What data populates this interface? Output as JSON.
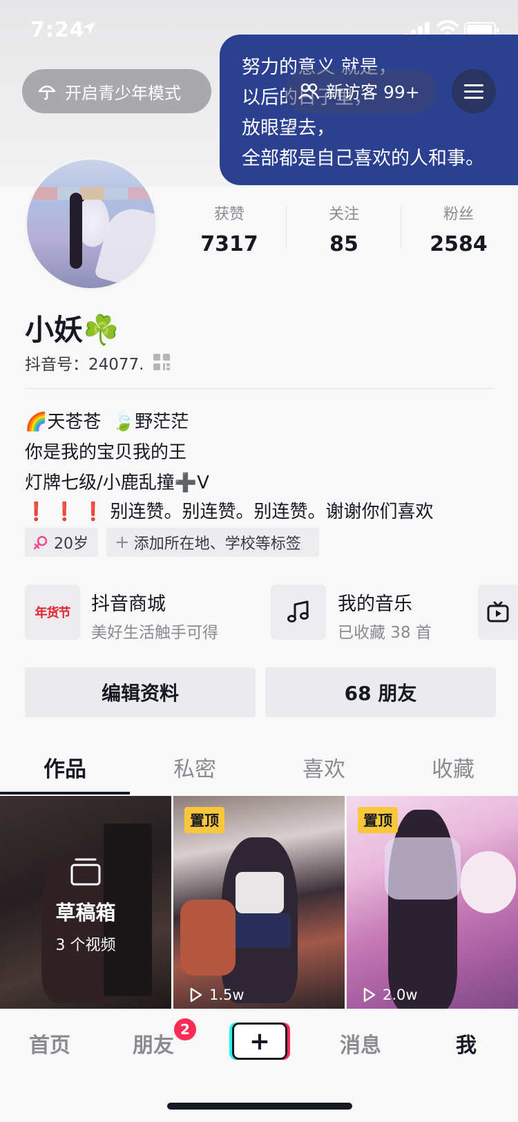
{
  "status_bar": {
    "time": "7:24"
  },
  "header": {
    "teen_mode_label": "开启青少年模式",
    "note_text": "努力的意义 就是，\n以后的日子里，\n放眼望去，\n全部都是自己喜欢的人和事。",
    "visitors_label": "新访客 99+"
  },
  "stats": [
    {
      "label": "获赞",
      "value": "7317"
    },
    {
      "label": "关注",
      "value": "85"
    },
    {
      "label": "粉丝",
      "value": "2584"
    }
  ],
  "profile": {
    "name": "小妖☘️",
    "douyin_id": "抖音号：24077."
  },
  "bio": {
    "line1": "🌈天苍苍  🍃野茫茫",
    "line2": "你是我的宝贝我的王",
    "line3": "灯牌七级/小鹿乱撞➕V",
    "line4_marks": "❗️ ❗️ ❗️",
    "line4_text": "别连赞。别连赞。别连赞。谢谢你们喜欢"
  },
  "tags": {
    "age": "20岁",
    "add_tags": "添加所在地、学校等标签"
  },
  "services": [
    {
      "icon_text": "年货节",
      "title": "抖音商城",
      "subtitle": "美好生活触手可得"
    },
    {
      "icon": "music-note-icon",
      "title": "我的音乐",
      "subtitle": "已收藏 38 首"
    }
  ],
  "actions": {
    "edit_profile": "编辑资料",
    "friends": "68 朋友"
  },
  "tabs": [
    "作品",
    "私密",
    "喜欢",
    "收藏"
  ],
  "videos": {
    "drafts_title": "草稿箱",
    "drafts_count": "3 个视频",
    "pinned_label": "置顶",
    "views_2": "1.5w",
    "views_3": "2.0w"
  },
  "bottom_nav": {
    "home": "首页",
    "friends": "朋友",
    "friends_badge": "2",
    "create": "+",
    "messages": "消息",
    "me": "我"
  }
}
